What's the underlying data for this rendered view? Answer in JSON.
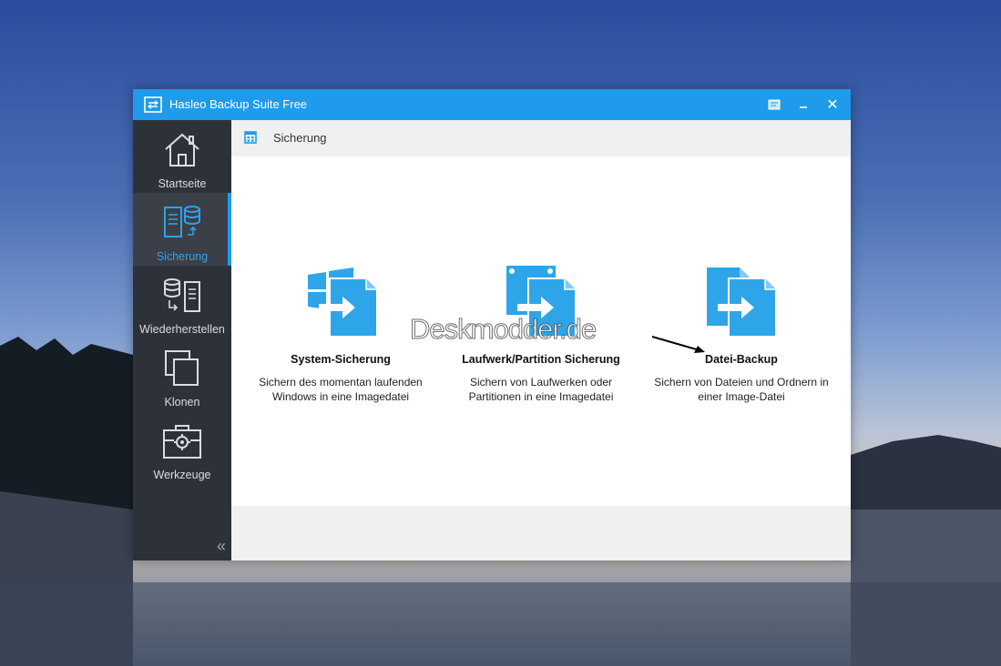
{
  "window": {
    "title": "Hasleo Backup Suite Free",
    "accent_color": "#1e9bea",
    "close_symbol": "✕"
  },
  "sidebar": {
    "items": [
      {
        "label": "Startseite",
        "icon": "home-icon"
      },
      {
        "label": "Sicherung",
        "icon": "backup-icon",
        "active": true
      },
      {
        "label": "Wiederherstellen",
        "icon": "restore-icon"
      },
      {
        "label": "Klonen",
        "icon": "clone-icon"
      },
      {
        "label": "Werkzeuge",
        "icon": "toolbox-icon"
      }
    ],
    "collapse_symbol": "«"
  },
  "breadcrumb": {
    "label": "Sicherung",
    "icon": "grid-icon"
  },
  "options": [
    {
      "title": "System-Sicherung",
      "desc_line1": "Sichern des momentan laufenden",
      "desc_line2": "Windows in eine Imagedatei",
      "icon": "windows-file-arrow-icon"
    },
    {
      "title": "Laufwerk/Partition Sicherung",
      "desc_line1": "Sichern von Laufwerken oder",
      "desc_line2": "Partitionen in eine Imagedatei",
      "icon": "disk-file-arrow-icon"
    },
    {
      "title": "Datei-Backup",
      "desc_line1": "Sichern von Dateien und Ordnern in",
      "desc_line2": "einer Image-Datei",
      "icon": "file-copy-arrow-icon"
    }
  ],
  "watermark": "Deskmodder.de"
}
